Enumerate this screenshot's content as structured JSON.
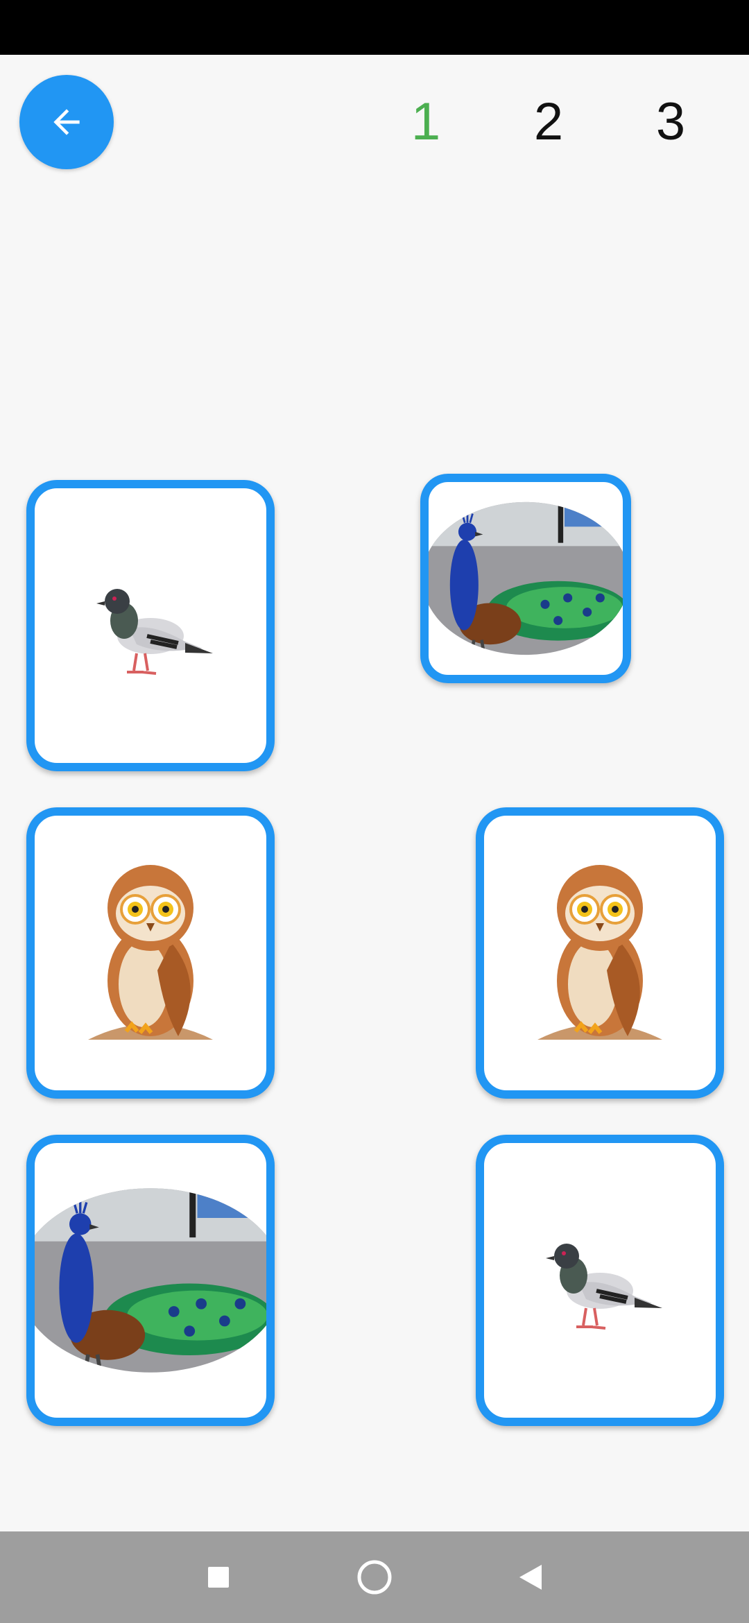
{
  "header": {
    "back_icon": "arrow-left-icon",
    "levels": [
      "1",
      "2",
      "3"
    ],
    "active_level": "1"
  },
  "cards": [
    {
      "animal": "pigeon"
    },
    {
      "animal": "peacock"
    },
    {
      "animal": "owl"
    },
    {
      "animal": "owl"
    },
    {
      "animal": "peacock"
    },
    {
      "animal": "pigeon"
    }
  ],
  "nav": {
    "recents_icon": "square-icon",
    "home_icon": "circle-icon",
    "back_icon": "triangle-back-icon"
  },
  "colors": {
    "accent": "#2196f3",
    "active_level": "#4caf50"
  }
}
